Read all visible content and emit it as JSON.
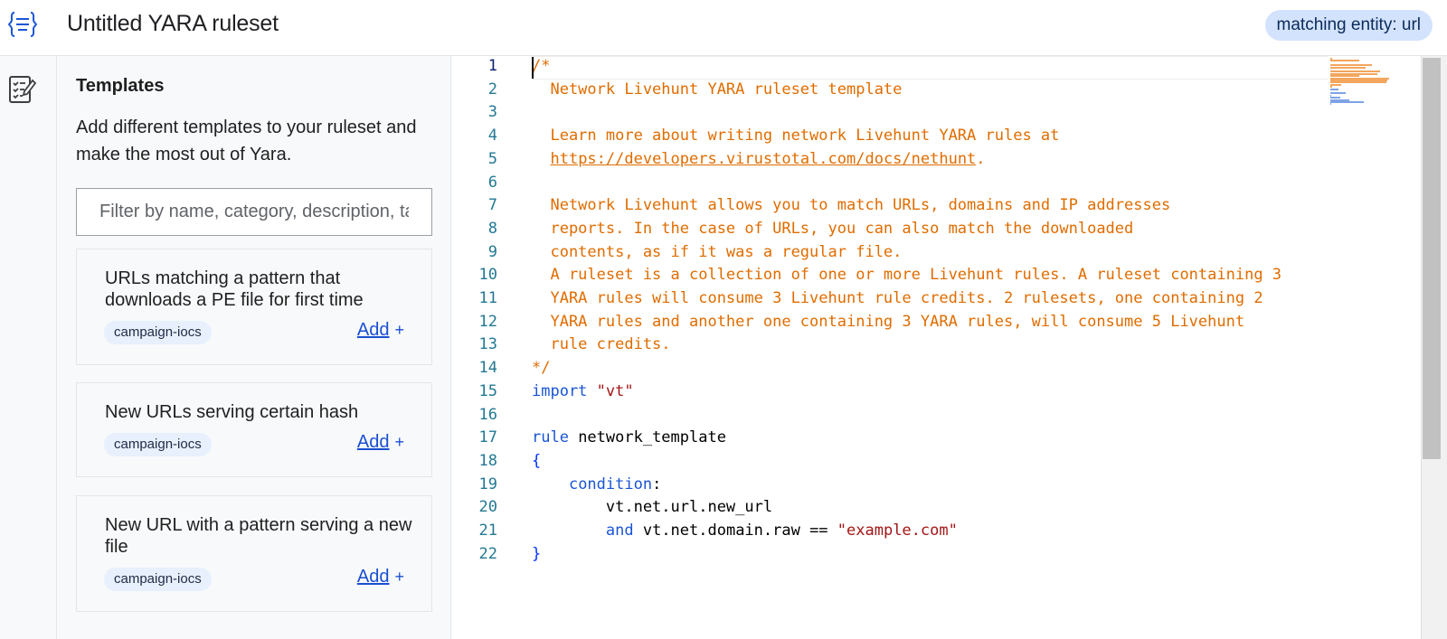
{
  "header": {
    "title": "Untitled YARA ruleset",
    "entity_chip": "matching entity: url",
    "logo_icon": "curly-braces-list-icon"
  },
  "rail": {
    "icon": "checklist-edit-icon"
  },
  "templates": {
    "title": "Templates",
    "description": "Add different templates to your ruleset and make the most out of Yara.",
    "filter_placeholder": "Filter by name, category, description, tags...",
    "add_label": "Add",
    "add_plus": "+",
    "cards": [
      {
        "title": "URLs matching a pattern that downloads a PE file for first time",
        "tag": "campaign-iocs"
      },
      {
        "title": "New URLs serving certain hash",
        "tag": "campaign-iocs"
      },
      {
        "title": "New URL with a pattern serving a new file",
        "tag": "campaign-iocs"
      }
    ]
  },
  "editor": {
    "lines": [
      {
        "n": "1",
        "tokens": [
          {
            "t": "/*",
            "c": "comment"
          }
        ]
      },
      {
        "n": "2",
        "tokens": [
          {
            "t": "  Network Livehunt YARA ruleset template",
            "c": "comment"
          }
        ]
      },
      {
        "n": "3",
        "tokens": [
          {
            "t": "",
            "c": "comment"
          }
        ]
      },
      {
        "n": "4",
        "tokens": [
          {
            "t": "  Learn more about writing network Livehunt YARA rules at",
            "c": "comment"
          }
        ]
      },
      {
        "n": "5",
        "tokens": [
          {
            "t": "  ",
            "c": "comment"
          },
          {
            "t": "https://developers.virustotal.com/docs/nethunt",
            "c": "link"
          },
          {
            "t": ".",
            "c": "comment"
          }
        ]
      },
      {
        "n": "6",
        "tokens": [
          {
            "t": "",
            "c": "comment"
          }
        ]
      },
      {
        "n": "7",
        "tokens": [
          {
            "t": "  Network Livehunt allows you to match URLs, domains and IP addresses",
            "c": "comment"
          }
        ]
      },
      {
        "n": "8",
        "tokens": [
          {
            "t": "  reports. In the case of URLs, you can also match the downloaded",
            "c": "comment"
          }
        ]
      },
      {
        "n": "9",
        "tokens": [
          {
            "t": "  contents, as if it was a regular file.",
            "c": "comment"
          }
        ]
      },
      {
        "n": "10",
        "tokens": [
          {
            "t": "  A ruleset is a collection of one or more Livehunt rules. A ruleset containing 3",
            "c": "comment"
          }
        ]
      },
      {
        "n": "11",
        "tokens": [
          {
            "t": "  YARA rules will consume 3 Livehunt rule credits. 2 rulesets, one containing 2",
            "c": "comment"
          }
        ]
      },
      {
        "n": "12",
        "tokens": [
          {
            "t": "  YARA rules and another one containing 3 YARA rules, will consume 5 Livehunt",
            "c": "comment"
          }
        ]
      },
      {
        "n": "13",
        "tokens": [
          {
            "t": "  rule credits.",
            "c": "comment"
          }
        ]
      },
      {
        "n": "14",
        "tokens": [
          {
            "t": "*/",
            "c": "comment"
          }
        ]
      },
      {
        "n": "15",
        "tokens": [
          {
            "t": "import",
            "c": "kw"
          },
          {
            "t": " ",
            "c": "plain"
          },
          {
            "t": "\"vt\"",
            "c": "str"
          }
        ]
      },
      {
        "n": "16",
        "tokens": [
          {
            "t": "",
            "c": "plain"
          }
        ]
      },
      {
        "n": "17",
        "tokens": [
          {
            "t": "rule",
            "c": "kw"
          },
          {
            "t": " network_template",
            "c": "plain"
          }
        ]
      },
      {
        "n": "18",
        "tokens": [
          {
            "t": "{",
            "c": "brace"
          }
        ]
      },
      {
        "n": "19",
        "tokens": [
          {
            "t": "    ",
            "c": "plain"
          },
          {
            "t": "condition",
            "c": "kw"
          },
          {
            "t": ":",
            "c": "plain"
          }
        ]
      },
      {
        "n": "20",
        "tokens": [
          {
            "t": "        vt.net.url.new_url",
            "c": "plain"
          }
        ]
      },
      {
        "n": "21",
        "tokens": [
          {
            "t": "        ",
            "c": "plain"
          },
          {
            "t": "and",
            "c": "kw"
          },
          {
            "t": " vt.net.domain.raw == ",
            "c": "plain"
          },
          {
            "t": "\"example.com\"",
            "c": "str"
          }
        ]
      },
      {
        "n": "22",
        "tokens": [
          {
            "t": "}",
            "c": "brace"
          }
        ]
      }
    ]
  }
}
